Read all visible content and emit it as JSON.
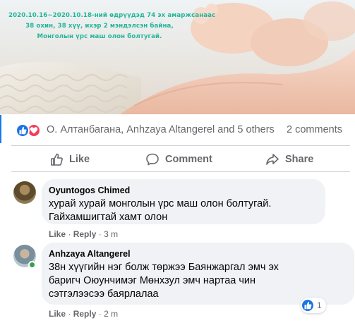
{
  "colors": {
    "accent": "#1877f2",
    "like_blue": "#1b74e4",
    "love_red": "#f33e58",
    "secondary_text": "#65676b",
    "bubble_bg": "#f0f2f5",
    "caption_green": "#23b59a",
    "online_green": "#31a24c"
  },
  "post_image": {
    "caption_lines": [
      "2020.10.16~2020.10.18-ний өдрүүдэд 74 эх амаржсанаас",
      "38 охин, 38 хүү, ихэр 2 мэндэлсэн байна,",
      "Монголын үрс маш олон болтугай."
    ]
  },
  "reactions": {
    "icons": [
      "like-icon",
      "love-icon"
    ],
    "reactors_text": "О. Алтанбагана, Anhzaya Altangerel and 5 others",
    "comments_count": "2 comments"
  },
  "actions": {
    "like": {
      "label": "Like",
      "icon": "thumbs-up-icon"
    },
    "comment": {
      "label": "Comment",
      "icon": "speech-bubble-icon"
    },
    "share": {
      "label": "Share",
      "icon": "share-arrow-icon"
    }
  },
  "comments": [
    {
      "author": "Oyuntogos Chimed",
      "lines": [
        "хурай хурай монголын үрс маш олон болтугай.",
        "Гайхамшигтай хамт олон"
      ],
      "like_label": "Like",
      "reply_label": "Reply",
      "time": "3 m"
    },
    {
      "author": "Anhzaya Altangerel",
      "lines": [
        "38н хүүгийн нэг болж төржээ Баянжаргал эмч эх",
        "баригч Оюунчимэг Мөнхзул эмч нартаа чин",
        "сэтгэлээсээ баярлалаа"
      ],
      "like_label": "Like",
      "reply_label": "Reply",
      "time": "2 m",
      "reaction_count": "1",
      "online": true
    }
  ]
}
